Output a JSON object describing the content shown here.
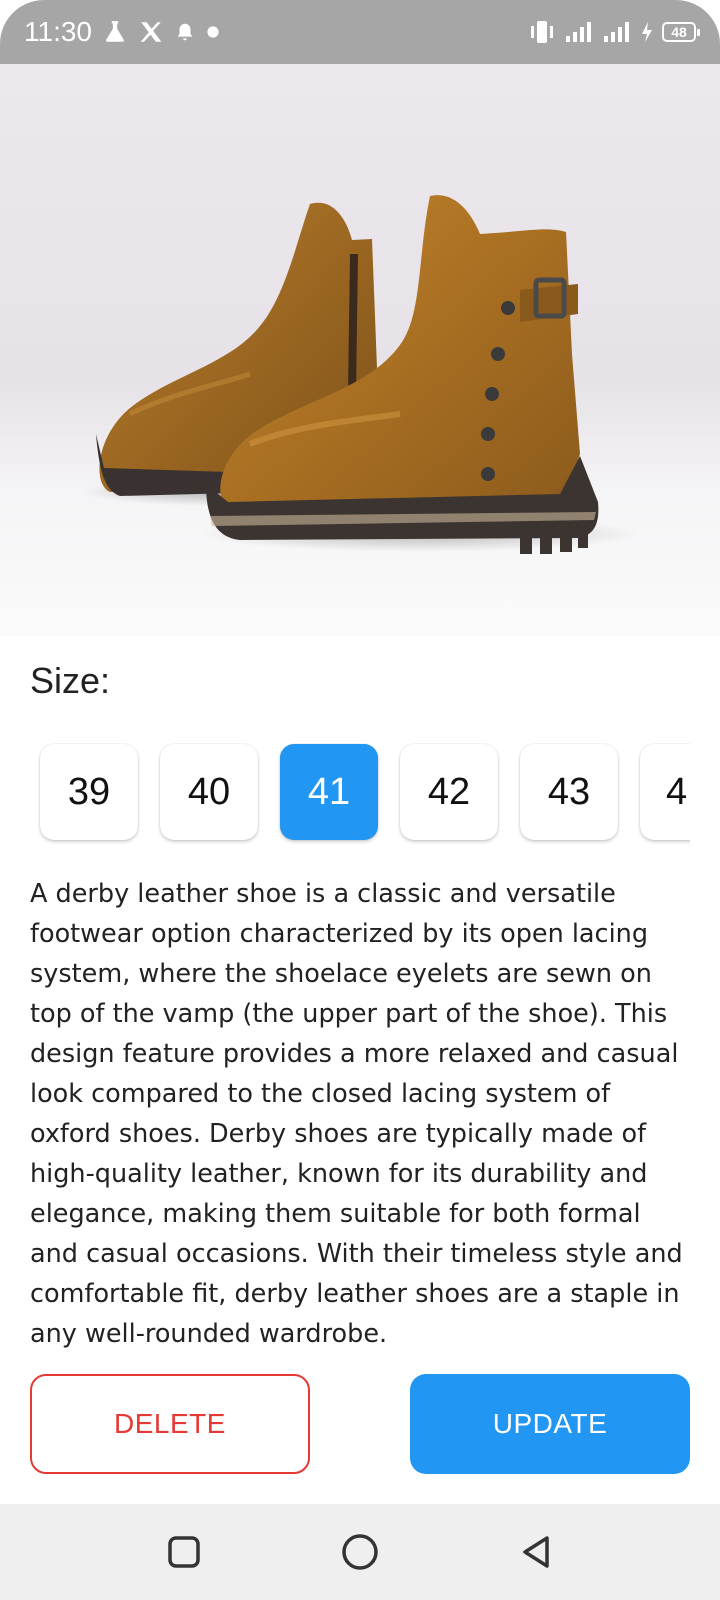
{
  "status_bar": {
    "time": "11:30",
    "battery": "48",
    "icons": [
      "flask-icon",
      "x-logo-icon",
      "notification-bell-icon",
      "dot-icon",
      "vibrate-icon",
      "signal-icon",
      "signal-icon",
      "charging-icon",
      "battery-icon"
    ]
  },
  "product": {
    "image_icon": "brown-leather-ankle-boots-image"
  },
  "size": {
    "title": "Size:",
    "options": [
      "39",
      "40",
      "41",
      "42",
      "43",
      "4"
    ],
    "selected": "41"
  },
  "description": "A derby leather shoe is a classic and versatile footwear option characterized by its open lacing system, where the shoelace eyelets are sewn on top of the vamp (the upper part of the shoe). This design feature provides a more relaxed and casual look compared to the closed lacing system of oxford shoes. Derby shoes are typically made of high-quality leather, known for its durability and elegance, making them suitable for both formal and casual occasions. With their timeless style and comfortable fit, derby leather shoes are a staple in any well-rounded wardrobe.",
  "actions": {
    "delete_label": "DELETE",
    "update_label": "UPDATE"
  },
  "colors": {
    "accent": "#2196f3",
    "danger": "#e53935"
  },
  "nav": {
    "icons": [
      "recent-apps-icon",
      "home-icon",
      "back-icon"
    ]
  }
}
